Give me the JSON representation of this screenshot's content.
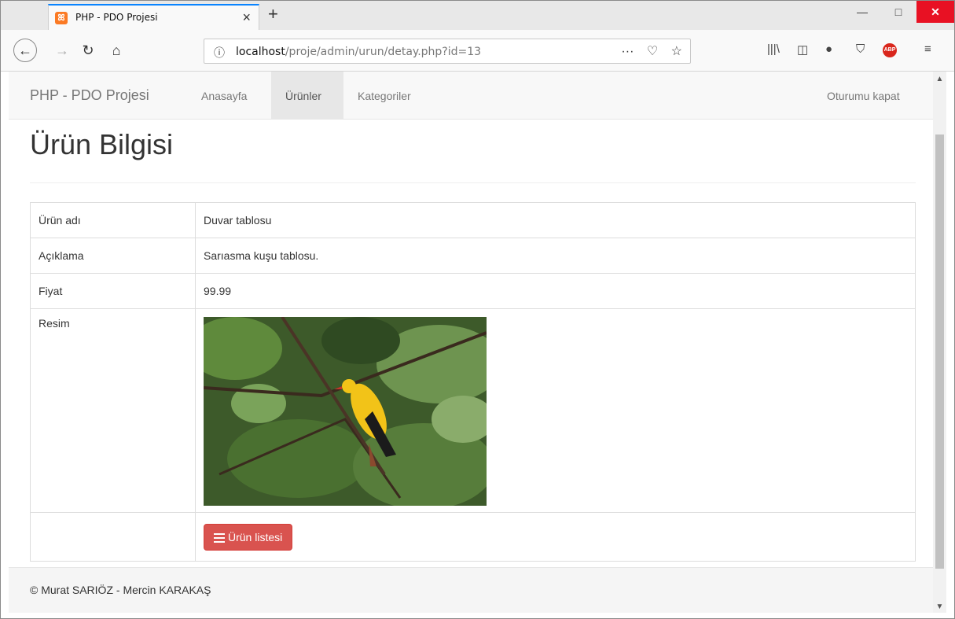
{
  "browser": {
    "tab_title": "PHP - PDO Projesi",
    "favicon_icon": "xampp-icon",
    "url_host": "localhost",
    "url_path": "/proje/admin/urun/detay.php?id=13",
    "window_controls": {
      "minimize": "—",
      "maximize": "□",
      "close": "✕"
    }
  },
  "site": {
    "brand": "PHP - PDO Projesi",
    "nav": {
      "home": "Anasayfa",
      "products": "Ürünler",
      "categories": "Kategoriler",
      "logout": "Oturumu kapat"
    }
  },
  "page": {
    "title": "Ürün Bilgisi",
    "rows": {
      "name_label": "Ürün adı",
      "name_value": "Duvar tablosu",
      "desc_label": "Açıklama",
      "desc_value": "Sarıasma kuşu tablosu.",
      "price_label": "Fiyat",
      "price_value": "99.99",
      "image_label": "Resim"
    },
    "list_button": "Ürün listesi"
  },
  "footer": {
    "text": "© Murat SARIÖZ - Mercin KARAKAŞ"
  },
  "colors": {
    "accent_tab": "#0a84ff",
    "button_danger": "#d9534f",
    "close_button": "#e81123"
  }
}
